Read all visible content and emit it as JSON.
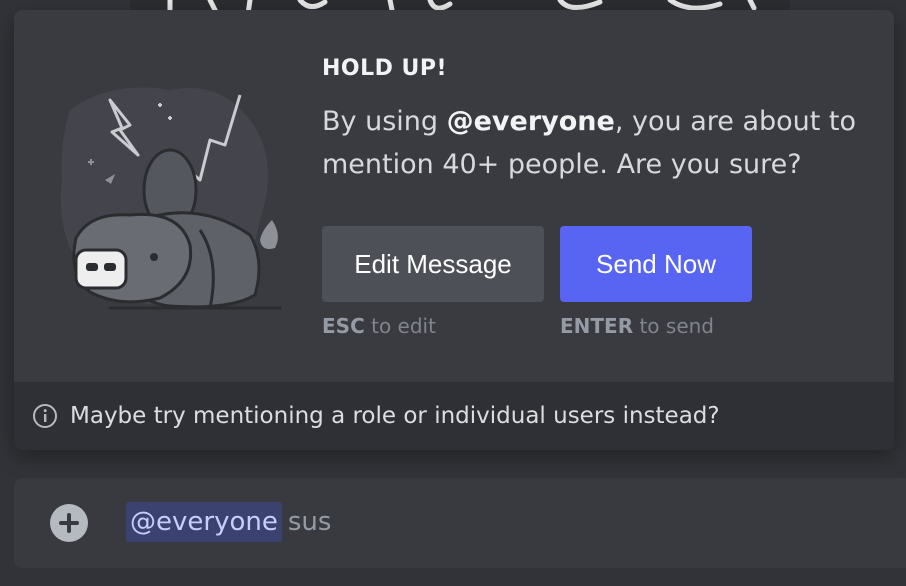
{
  "modal": {
    "title": "HOLD UP!",
    "body": {
      "prefix": "By using ",
      "mention": "@everyone",
      "suffix": ", you are about to mention 40+ people. Are you sure?"
    },
    "buttons": {
      "edit_label": "Edit Message",
      "send_label": "Send Now"
    },
    "hints": {
      "edit_key": "ESC",
      "edit_text": " to edit",
      "send_key": "ENTER",
      "send_text": " to send"
    },
    "footer": {
      "icon": "info-icon",
      "text": "Maybe try mentioning a role or individual users instead?"
    }
  },
  "composer": {
    "icon": "plus-circle-icon",
    "mention": "@everyone",
    "text": "sus"
  },
  "colors": {
    "primary_button": "#5865f2",
    "secondary_button": "#4e5058",
    "modal_background": "#3a3b41",
    "footer_background": "#2f3035",
    "mention_highlight": "#3c4270"
  }
}
